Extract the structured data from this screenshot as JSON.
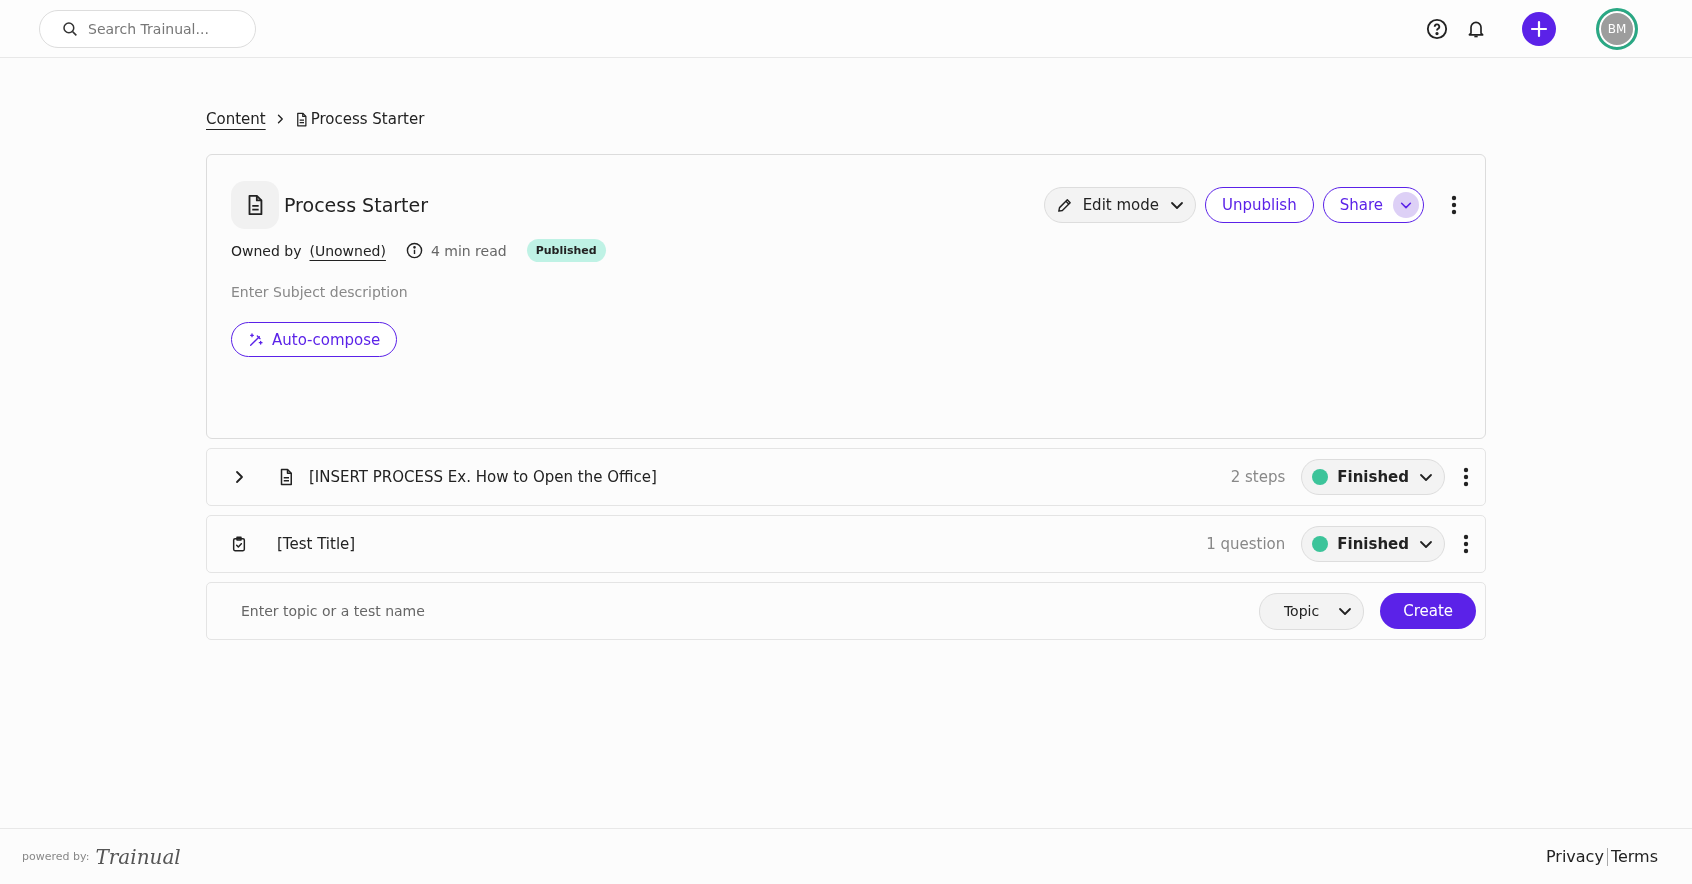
{
  "topbar": {
    "search": {
      "placeholder": "Search Trainual..."
    },
    "avatar": {
      "initials": "BM"
    }
  },
  "breadcrumb": [
    {
      "label": "Content",
      "kind": "link"
    },
    {
      "label": "Process Starter",
      "kind": "current"
    }
  ],
  "subject": {
    "title": "Process Starter",
    "owned_by_label": "Owned by",
    "owner": "(Unowned)",
    "read_time": "4 min read",
    "status_badge": "Published",
    "description": {
      "placeholder": "Enter Subject description"
    },
    "auto_compose": "Auto-compose",
    "actions": {
      "edit_mode": "Edit mode",
      "unpublish": "Unpublish",
      "share": "Share"
    }
  },
  "items": [
    {
      "kind": "topic",
      "title": "[INSERT PROCESS Ex. How to Open the Office]",
      "count": "2 steps",
      "status": "Finished",
      "color": "#3cc49a",
      "expanded": false
    },
    {
      "kind": "test",
      "title": "[Test Title]",
      "count": "1 question",
      "status": "Finished",
      "color": "#3cc49a"
    }
  ],
  "create_row": {
    "placeholder": "Enter topic or a test name",
    "type_select": "Topic",
    "button": "Create"
  },
  "footer": {
    "powered_by": "powered by:",
    "brand": "Trainual",
    "links": [
      "Privacy",
      "Terms"
    ]
  }
}
